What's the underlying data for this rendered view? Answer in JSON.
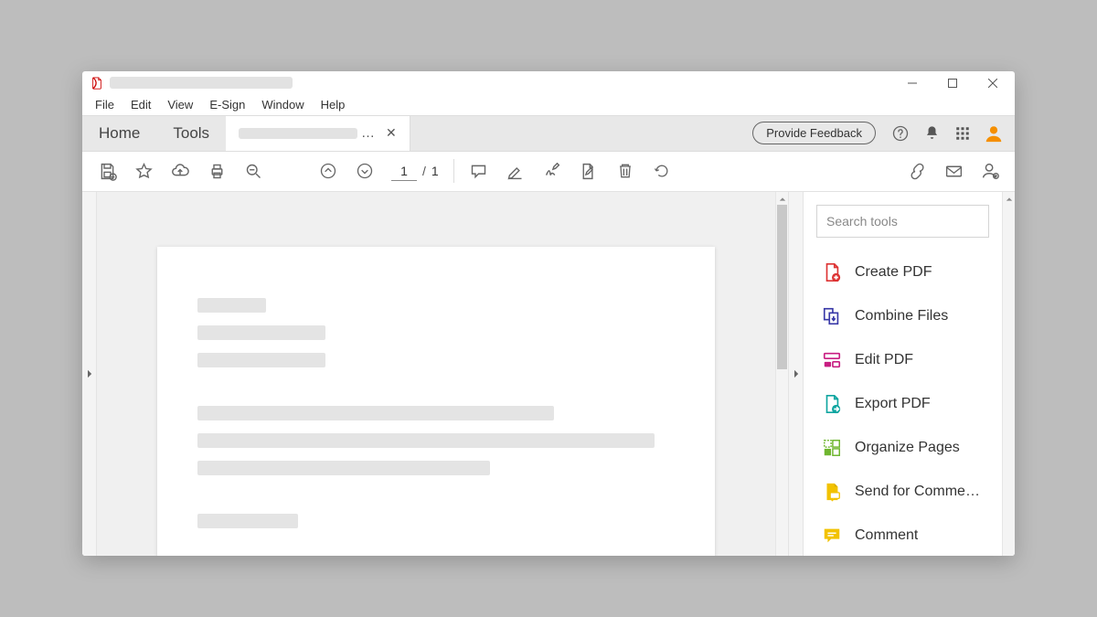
{
  "menu": {
    "file": "File",
    "edit": "Edit",
    "view": "View",
    "esign": "E-Sign",
    "window": "Window",
    "help": "Help"
  },
  "maintabs": {
    "home": "Home",
    "tools": "Tools"
  },
  "feedback_label": "Provide Feedback",
  "page": {
    "current": "1",
    "sep": "/",
    "total": "1"
  },
  "search": {
    "placeholder": "Search tools"
  },
  "tools": {
    "create": "Create PDF",
    "combine": "Combine Files",
    "edit": "Edit PDF",
    "export": "Export PDF",
    "organize": "Organize Pages",
    "send_comment": "Send for Comme…",
    "comment": "Comment"
  }
}
